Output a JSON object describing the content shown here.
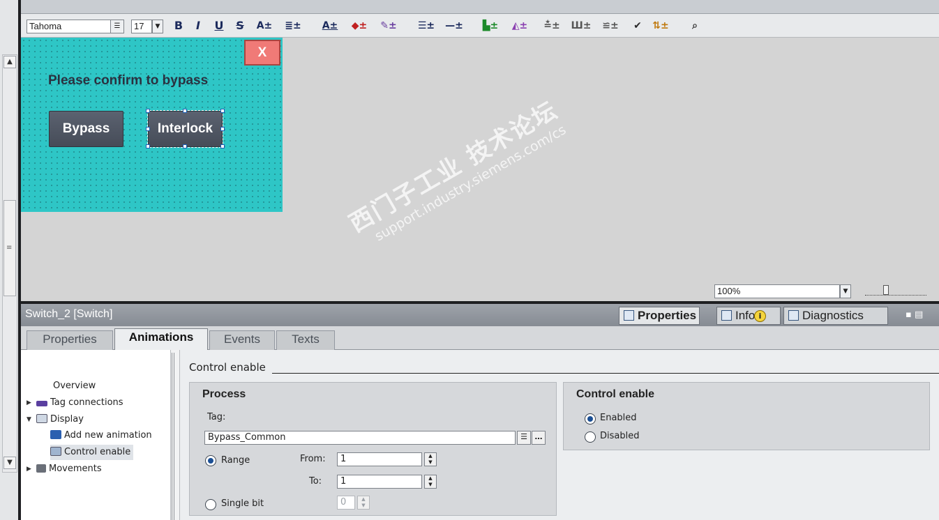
{
  "toolbar": {
    "font_name": "Tahoma",
    "font_size": "17",
    "bold_label": "B",
    "italic_label": "I",
    "underline_label": "U",
    "strike_label": "S"
  },
  "hmi_screen": {
    "close_label": "X",
    "prompt": "Please confirm to bypass",
    "bypass_label": "Bypass",
    "interlock_label": "Interlock",
    "bg_color": "#2ec6c6"
  },
  "canvas": {
    "zoom": "100%"
  },
  "inspector": {
    "title": "Switch_2 [Switch]",
    "head_tabs": {
      "properties": "Properties",
      "info": "Info",
      "diagnostics": "Diagnostics"
    },
    "sub_tabs": [
      "Properties",
      "Animations",
      "Events",
      "Texts"
    ],
    "active_sub_tab": "Animations"
  },
  "tree": {
    "overview": "Overview",
    "tag_connections": "Tag connections",
    "display": "Display",
    "add_new_animation": "Add new animation",
    "control_enable": "Control enable",
    "movements": "Movements"
  },
  "main": {
    "section_title": "Control enable",
    "process": {
      "title": "Process",
      "tag_label": "Tag:",
      "tag_value": "Bypass_Common",
      "range_label": "Range",
      "from_label": "From:",
      "from_value": "1",
      "to_label": "To:",
      "to_value": "1",
      "single_bit_label": "Single bit",
      "bit_value": "0",
      "range_selected": true
    },
    "control_enable": {
      "title": "Control enable",
      "enabled_label": "Enabled",
      "disabled_label": "Disabled",
      "enabled_selected": true
    }
  },
  "watermark": {
    "line1": "西门子工业 技术论坛",
    "line2": "support.industry.siemens.com/cs"
  }
}
